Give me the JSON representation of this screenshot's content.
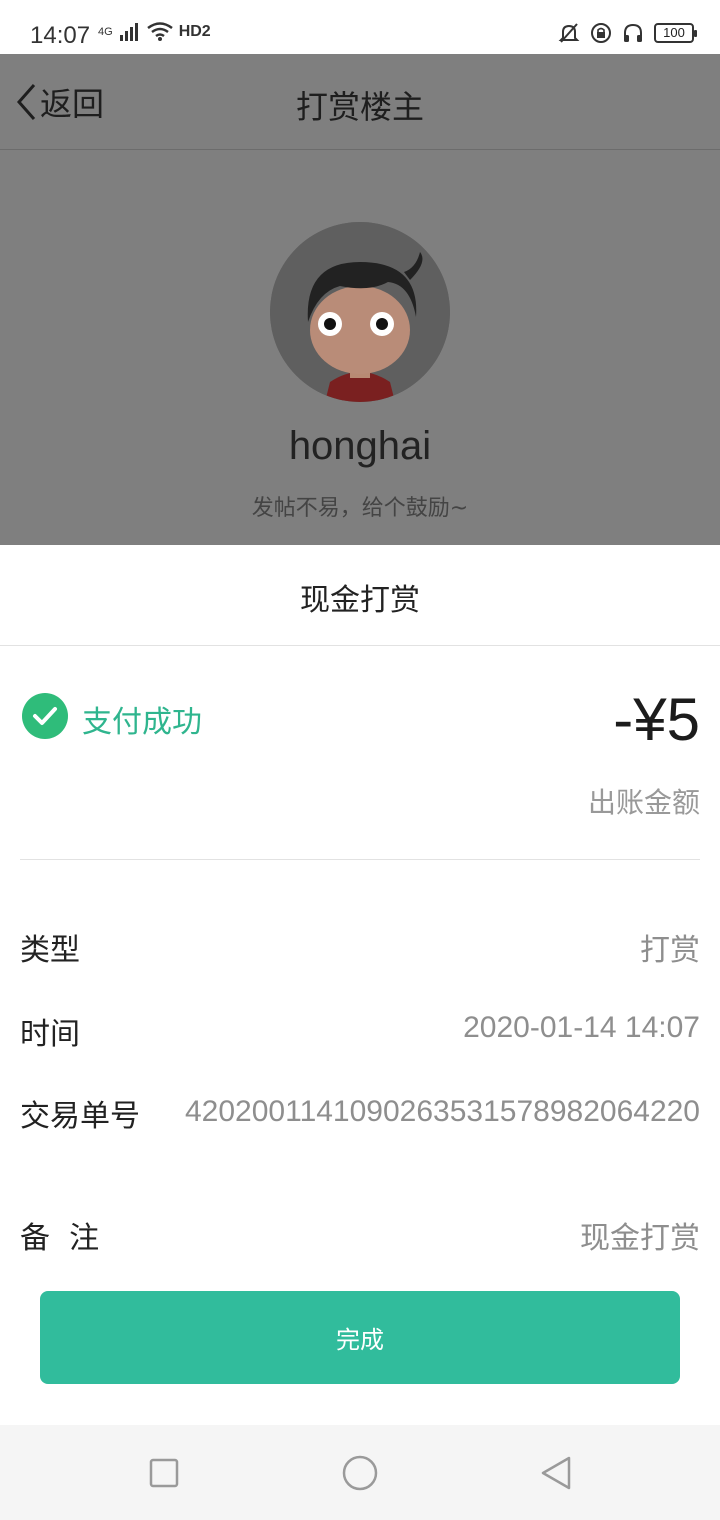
{
  "status_bar": {
    "time": "14:07",
    "network": "4G",
    "hd": "HD2",
    "battery": "100"
  },
  "nav": {
    "back_label": "返回",
    "title": "打赏楼主"
  },
  "profile": {
    "username": "honghai",
    "slogan": "发帖不易，给个鼓励~"
  },
  "sheet": {
    "title": "现金打赏",
    "status": "支付成功",
    "amount": "-¥5",
    "amount_label": "出账金额",
    "rows": [
      {
        "label": "类型",
        "value": "打赏"
      },
      {
        "label": "时间",
        "value": "2020-01-14 14:07"
      },
      {
        "label": "交易单号",
        "value": "4202001141090263531578982064220"
      },
      {
        "label": "备  注",
        "value": "现金打赏"
      }
    ],
    "done_button": "完成"
  },
  "colors": {
    "accent": "#31bc9c",
    "success": "#2fbc7a",
    "dim_overlay": "#7f7f7f"
  },
  "icons": [
    "signal-icon",
    "wifi-icon",
    "bell-off-icon",
    "lock-rotate-icon",
    "headphones-icon",
    "battery-icon",
    "chevron-left-icon",
    "check-circle-icon",
    "square-icon",
    "circle-icon",
    "triangle-back-icon"
  ]
}
